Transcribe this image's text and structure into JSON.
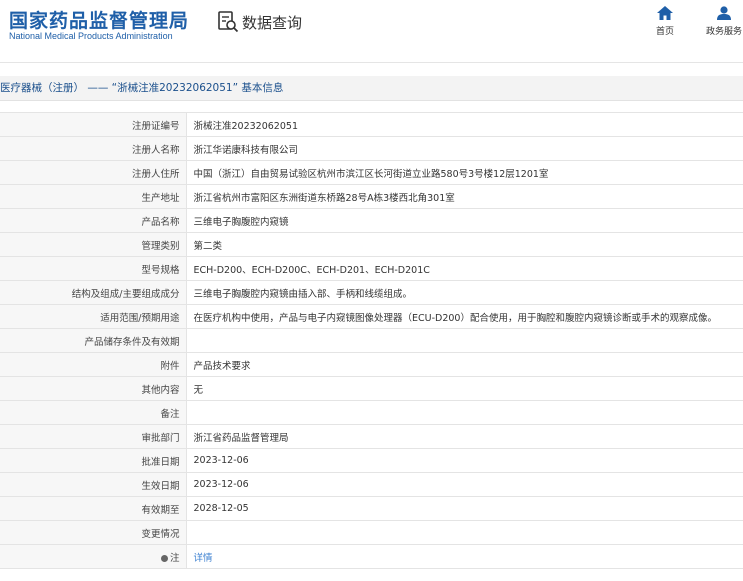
{
  "header": {
    "logo_cn": "国家药品监督管理局",
    "logo_en": "National Medical Products Administration",
    "query_title": "数据查询",
    "nav": [
      {
        "label": "首页",
        "icon": "home-icon"
      },
      {
        "label": "政务服务",
        "icon": "user-icon"
      }
    ]
  },
  "breadcrumb": "医疗器械（注册） —— “浙械注准20232062051” 基本信息",
  "colors": {
    "brand": "#1f5fa8",
    "link": "#3a7fd0",
    "label_bg": "#f7f7f7"
  },
  "details": {
    "rows": [
      {
        "label": "注册证编号",
        "value": "浙械注准20232062051"
      },
      {
        "label": "注册人名称",
        "value": "浙江华诺康科技有限公司"
      },
      {
        "label": "注册人住所",
        "value": "中国（浙江）自由贸易试验区杭州市滨江区长河街道立业路580号3号楼12层1201室"
      },
      {
        "label": "生产地址",
        "value": "浙江省杭州市富阳区东洲街道东桥路28号A栋3楼西北角301室"
      },
      {
        "label": "产品名称",
        "value": "三维电子胸腹腔内窥镜"
      },
      {
        "label": "管理类别",
        "value": "第二类"
      },
      {
        "label": "型号规格",
        "value": "ECH-D200、ECH-D200C、ECH-D201、ECH-D201C"
      },
      {
        "label": "结构及组成/主要组成成分",
        "value": "三维电子胸腹腔内窥镜由插入部、手柄和线缆组成。"
      },
      {
        "label": "适用范围/预期用途",
        "value": "在医疗机构中使用，产品与电子内窥镜图像处理器（ECU-D200）配合使用，用于胸腔和腹腔内窥镜诊断或手术的观察成像。"
      },
      {
        "label": "产品储存条件及有效期",
        "value": ""
      },
      {
        "label": "附件",
        "value": "产品技术要求"
      },
      {
        "label": "其他内容",
        "value": "无"
      },
      {
        "label": "备注",
        "value": ""
      },
      {
        "label": "审批部门",
        "value": "浙江省药品监督管理局"
      },
      {
        "label": "批准日期",
        "value": "2023-12-06"
      },
      {
        "label": "生效日期",
        "value": "2023-12-06"
      },
      {
        "label": "有效期至",
        "value": "2028-12-05"
      },
      {
        "label": "变更情况",
        "value": ""
      },
      {
        "label": "注",
        "value": "详情"
      }
    ]
  }
}
